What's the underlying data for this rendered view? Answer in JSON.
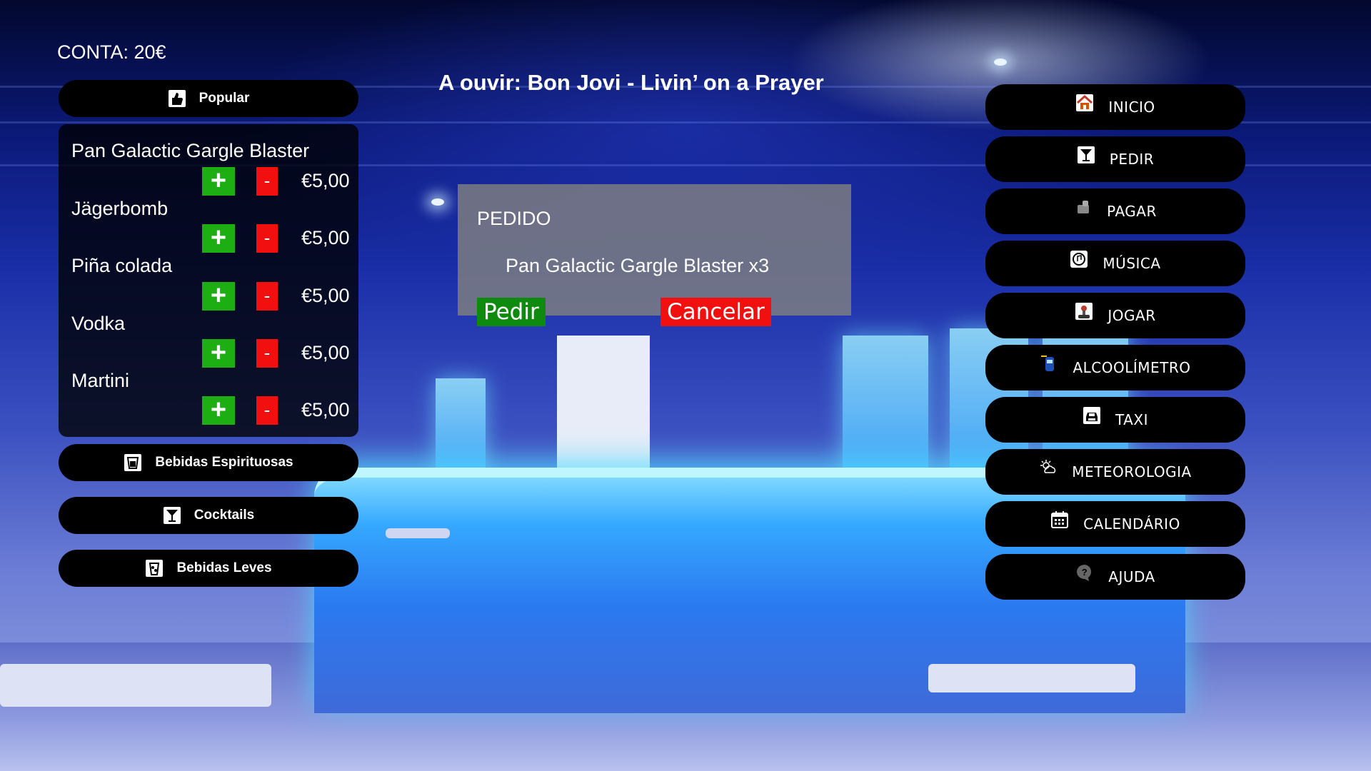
{
  "account": {
    "label": "CONTA: 20€"
  },
  "now_playing": "A ouvir: Bon Jovi - Livin’ on a Prayer",
  "categories": [
    {
      "label": "Popular",
      "icon": "thumbs-up-icon"
    },
    {
      "label": "Bebidas Espirituosas",
      "icon": "whiskey-glass-icon"
    },
    {
      "label": "Cocktails",
      "icon": "cocktail-icon"
    },
    {
      "label": "Bebidas Leves",
      "icon": "soft-drink-icon"
    }
  ],
  "drinks": [
    {
      "name": "Pan Galactic Gargle Blaster",
      "price": "€5,00"
    },
    {
      "name": "Jägerbomb",
      "price": "€5,00"
    },
    {
      "name": "Piña colada",
      "price": "€5,00"
    },
    {
      "name": "Vodka",
      "price": "€5,00"
    },
    {
      "name": "Martini",
      "price": "€5,00"
    }
  ],
  "buttons": {
    "plus": "+",
    "minus": "-"
  },
  "order": {
    "title": "PEDIDO",
    "items": [
      "Pan Galactic Gargle Blaster x3"
    ],
    "confirm_label": "Pedir",
    "cancel_label": "Cancelar"
  },
  "nav": [
    {
      "label": "INICIO",
      "icon": "home-icon"
    },
    {
      "label": "PEDIR",
      "icon": "cocktail-icon"
    },
    {
      "label": "PAGAR",
      "icon": "payment-icon"
    },
    {
      "label": "MÚSICA",
      "icon": "music-icon"
    },
    {
      "label": "JOGAR",
      "icon": "game-icon"
    },
    {
      "label": "ALCOOLÍMETRO",
      "icon": "breathalyzer-icon"
    },
    {
      "label": "TAXI",
      "icon": "taxi-icon"
    },
    {
      "label": "METEOROLOGIA",
      "icon": "weather-icon"
    },
    {
      "label": "CALENDÁRIO",
      "icon": "calendar-icon"
    },
    {
      "label": "AJUDA",
      "icon": "help-icon"
    }
  ],
  "colors": {
    "plus": "#1cae12",
    "minus": "#f20f0f",
    "pedir": "#0e8a0e",
    "cancelar": "#f01010",
    "pill": "#000000"
  }
}
